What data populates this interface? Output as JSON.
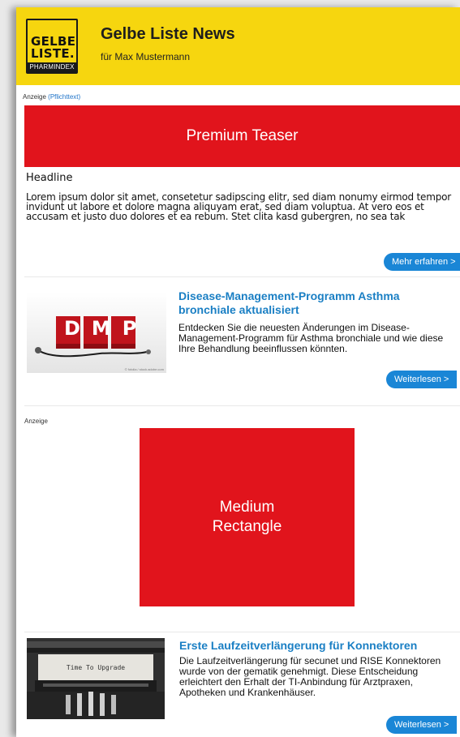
{
  "header": {
    "logo_line1": "GELBE",
    "logo_line2": "LISTE.",
    "logo_band": "PHARMINDEX",
    "title": "Gelbe Liste News",
    "subtitle": "für Max Mustermann"
  },
  "ad1": {
    "label": "Anzeige",
    "link": "(Pflichttext)",
    "banner": "Premium Teaser",
    "headline": "Headline",
    "body": "Lorem ipsum dolor sit amet, consetetur sadipscing elitr, sed diam nonumy eirmod tempor invidunt ut labore et dolore magna aliquyam erat, sed diam voluptua. At vero eos et accusam et justo duo dolores et ea rebum. Stet clita kasd gubergren, no sea tak",
    "button": "Mehr erfahren >"
  },
  "article1": {
    "image_text": "DMP",
    "image_credit": "© fotolia / stock.adobe.com",
    "title": "Disease-Management-Programm Asthma bronchiale aktualisiert",
    "text": "Entdecken Sie die neuesten Änderungen im Disease-Management-Programm für Asthma bronchiale und wie diese Ihre Behandlung beeinflussen könnten.",
    "button": "Weiterlesen >"
  },
  "ad2": {
    "label": "Anzeige",
    "banner_line1": "Medium",
    "banner_line2": "Rectangle"
  },
  "article2": {
    "image_text": "Time To Upgrade",
    "title": "Erste Laufzeitverlängerung für Konnektoren",
    "text": "Die Laufzeitverlängerung für secunet und RISE Konnektoren wurde von der gematik genehmigt. Diese Entscheidung erleichtert den Erhalt der TI-Anbindung für Arztpraxen, Apotheken und Krankenhäuser.",
    "button": "Weiterlesen >"
  },
  "colors": {
    "brand_yellow": "#f6d60f",
    "ad_red": "#e1141c",
    "link_blue": "#1a7fc4",
    "button_blue": "#1a86d6"
  }
}
